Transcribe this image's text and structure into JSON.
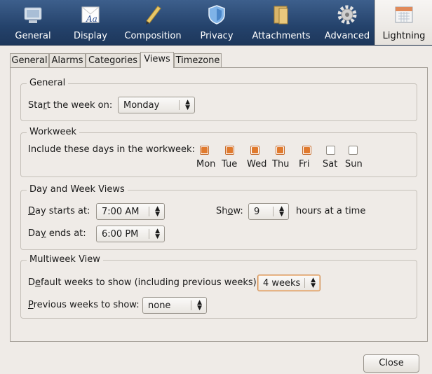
{
  "toolbar": {
    "items": [
      {
        "label": "General",
        "icon": "general-icon"
      },
      {
        "label": "Display",
        "icon": "display-icon"
      },
      {
        "label": "Composition",
        "icon": "composition-icon"
      },
      {
        "label": "Privacy",
        "icon": "privacy-icon"
      },
      {
        "label": "Attachments",
        "icon": "attachments-icon"
      },
      {
        "label": "Advanced",
        "icon": "advanced-icon"
      },
      {
        "label": "Lightning",
        "icon": "lightning-icon",
        "active": true
      }
    ]
  },
  "tabs": [
    {
      "label": "General"
    },
    {
      "label": "Alarms"
    },
    {
      "label": "Categories"
    },
    {
      "label": "Views",
      "active": true
    },
    {
      "label": "Timezone"
    }
  ],
  "general": {
    "title": "General",
    "start_week_label": "Start the week on:",
    "start_week_value": "Monday"
  },
  "workweek": {
    "title": "Workweek",
    "include_label": "Include these days in the workweek:",
    "days": [
      {
        "label": "Mon",
        "checked": true
      },
      {
        "label": "Tue",
        "checked": true
      },
      {
        "label": "Wed",
        "checked": true
      },
      {
        "label": "Thu",
        "checked": true
      },
      {
        "label": "Fri",
        "checked": true
      },
      {
        "label": "Sat",
        "checked": false
      },
      {
        "label": "Sun",
        "checked": false
      }
    ]
  },
  "day_week": {
    "title": "Day and Week Views",
    "day_starts_label": "Day starts at:",
    "day_starts_value": "7:00 AM",
    "day_ends_label": "Day ends at:",
    "day_ends_value": "6:00 PM",
    "show_label": "Show:",
    "show_value": "9",
    "hours_label": "hours at a time"
  },
  "multiweek": {
    "title": "Multiweek View",
    "default_weeks_label": "Default weeks to show (including previous weeks):",
    "default_weeks_value": "4 weeks",
    "previous_weeks_label": "Previous weeks to show:",
    "previous_weeks_value": "none"
  },
  "footer": {
    "close_label": "Close"
  },
  "colors": {
    "toolbar": "#24426b",
    "checkbox_on": "#e07a2e",
    "focus": "#d08b4d"
  }
}
